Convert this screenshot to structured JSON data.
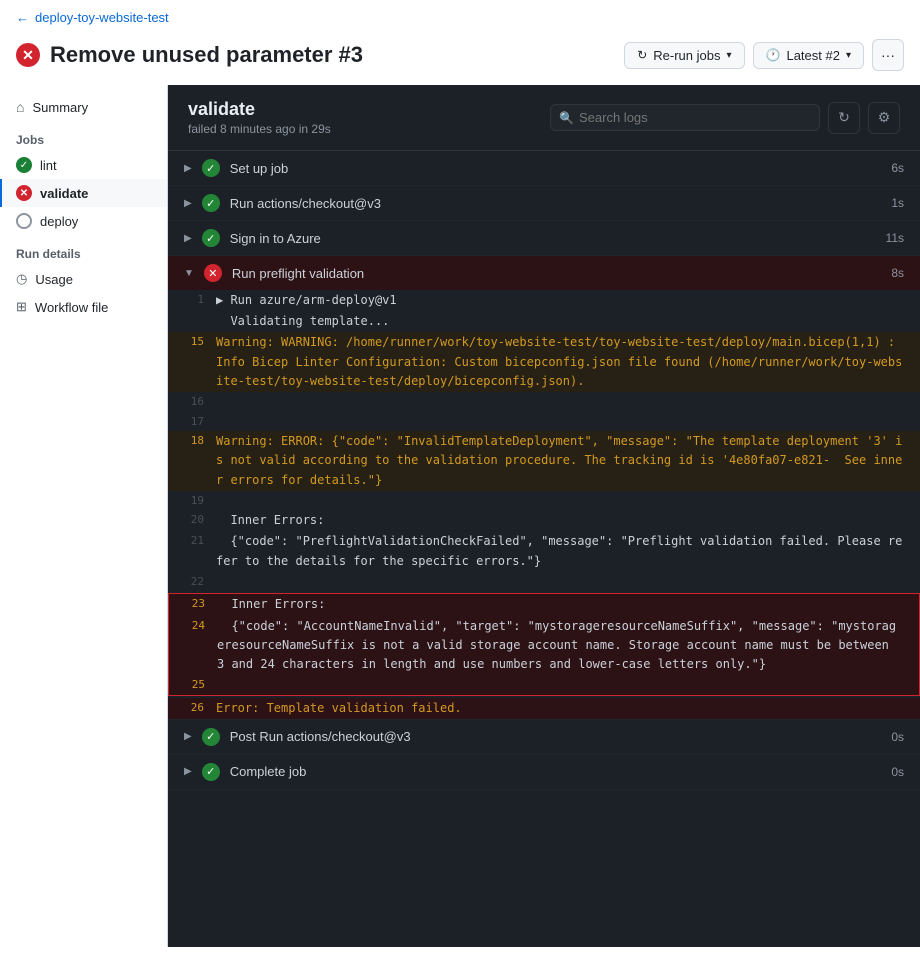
{
  "breadcrumb": {
    "back_label": "deploy-toy-website-test"
  },
  "page": {
    "title": "Remove unused parameter #3",
    "rerun_label": "Re-run jobs",
    "latest_label": "Latest #2"
  },
  "sidebar": {
    "summary_label": "Summary",
    "jobs_label": "Jobs",
    "lint_label": "lint",
    "validate_label": "validate",
    "deploy_label": "deploy",
    "run_details_label": "Run details",
    "usage_label": "Usage",
    "workflow_file_label": "Workflow file"
  },
  "validate_panel": {
    "title": "validate",
    "subtitle": "failed 8 minutes ago in 29s",
    "search_placeholder": "Search logs"
  },
  "steps": [
    {
      "id": "setup",
      "label": "Set up job",
      "time": "6s",
      "status": "success",
      "expanded": false
    },
    {
      "id": "checkout",
      "label": "Run actions/checkout@v3",
      "time": "1s",
      "status": "success",
      "expanded": false
    },
    {
      "id": "signin",
      "label": "Sign in to Azure",
      "time": "11s",
      "status": "success",
      "expanded": false
    },
    {
      "id": "preflight",
      "label": "Run preflight validation",
      "time": "8s",
      "status": "error",
      "expanded": true
    },
    {
      "id": "postrun",
      "label": "Post Run actions/checkout@v3",
      "time": "0s",
      "status": "success",
      "expanded": false
    },
    {
      "id": "complete",
      "label": "Complete job",
      "time": "0s",
      "status": "success",
      "expanded": false
    }
  ],
  "log_lines": [
    {
      "num": "1",
      "content": "▶ Run azure/arm-deploy@v1",
      "type": "plain"
    },
    {
      "num": "",
      "content": "  Validating template...",
      "type": "plain"
    },
    {
      "num": "15",
      "content": "Warning: WARNING: /home/runner/work/toy-website-test/toy-website-test/deploy/main.bicep(1,1) : Info Bicep Linter Configuration: Custom bicepconfig.json file found (/home/runner/work/toy-website-test/toy-website-test/deploy/bicepconfig.json).",
      "type": "warning"
    },
    {
      "num": "16",
      "content": "",
      "type": "plain"
    },
    {
      "num": "17",
      "content": "",
      "type": "plain"
    },
    {
      "num": "18",
      "content": "Warning: ERROR: {\"code\": \"InvalidTemplateDeployment\", \"message\": \"The template deployment '3' is not valid according to the validation procedure. The tracking id is '4e80fa07-e821-  See inner errors for details.\"}",
      "type": "warning"
    },
    {
      "num": "19",
      "content": "",
      "type": "plain"
    },
    {
      "num": "20",
      "content": "  Inner Errors:",
      "type": "plain"
    },
    {
      "num": "21",
      "content": "  {\"code\": \"PreflightValidationCheckFailed\", \"message\": \"Preflight validation failed. Please refer to the details for the specific errors.\"}",
      "type": "plain"
    },
    {
      "num": "22",
      "content": "",
      "type": "plain"
    },
    {
      "num": "23",
      "content": "  Inner Errors:",
      "type": "highlighted"
    },
    {
      "num": "24",
      "content": "  {\"code\": \"AccountNameInvalid\", \"target\": \"mystorageresourceNameSuffix\", \"message\": \"mystorageresourceNameSuffix is not a valid storage account name. Storage account name must be between 3 and 24 characters in length and use numbers and lower-case letters only.\"}",
      "type": "highlighted"
    },
    {
      "num": "25",
      "content": "",
      "type": "highlighted"
    },
    {
      "num": "26",
      "content": "Error: Template validation failed.",
      "type": "error-line"
    }
  ]
}
